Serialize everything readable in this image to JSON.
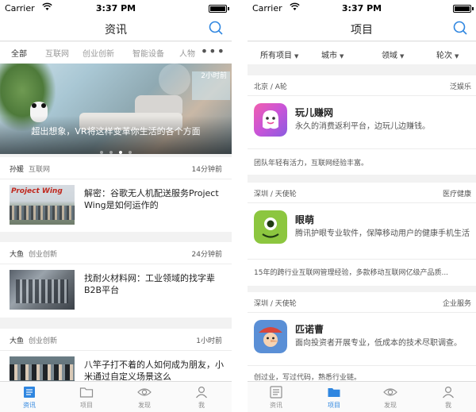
{
  "status": {
    "carrier": "Carrier",
    "time": "3:37 PM"
  },
  "left": {
    "title": "资讯",
    "tabs": [
      "全部",
      "互联网",
      "创业创新",
      "智能设备",
      "人物"
    ],
    "more": "•••",
    "banner": {
      "caption": "超出想象，VR将这样变革你生活的各个方面",
      "corner": "2小时前"
    },
    "articles": [
      {
        "author": "孙媛",
        "category": "互联网",
        "time": "14分钟前",
        "title": "解密：谷歌无人机配送服务Project Wing是如何运作的",
        "thumb_text": "Project Wing"
      },
      {
        "author": "大鱼",
        "category": "创业创新",
        "time": "24分钟前",
        "title": "找耐火材料网：工业领域的找字辈B2B平台"
      },
      {
        "author": "大鱼",
        "category": "创业创新",
        "time": "1小时前",
        "title": "八竿子打不着的人如何成为朋友，小米通过自定义场景这么"
      }
    ],
    "tabbar": [
      "资讯",
      "项目",
      "发现",
      "我"
    ]
  },
  "right": {
    "title": "项目",
    "filters": [
      "所有项目",
      "城市",
      "领域",
      "轮次"
    ],
    "projects": [
      {
        "location": "北京 / A轮",
        "field": "泛娱乐",
        "name": "玩儿赚网",
        "desc": "永久的消费返利平台，边玩儿边赚钱。",
        "note": "团队年轻有活力，互联网经验丰富。"
      },
      {
        "location": "深圳 / 天使轮",
        "field": "医疗健康",
        "name": "眼萌",
        "desc": "腾讯护眼专业软件，保障移动用户的健康手机生活",
        "note": "15年的跨行业互联网管理经验，多款移动互联网亿级产品质..."
      },
      {
        "location": "深圳 / 天使轮",
        "field": "企业服务",
        "name": "匹诺曹",
        "desc": "面向投资者开展专业，低成本的技术尽职调查。",
        "note": "创过业，写过代码，熟悉行业链。"
      }
    ],
    "tabbar": [
      "资讯",
      "项目",
      "发现",
      "我"
    ]
  },
  "colors": {
    "accent": "#2f86e0",
    "logo_wanr": "#e8499a",
    "logo_yanmeng": "#8cc63f",
    "logo_pinuocao": "#5a8fd6"
  }
}
